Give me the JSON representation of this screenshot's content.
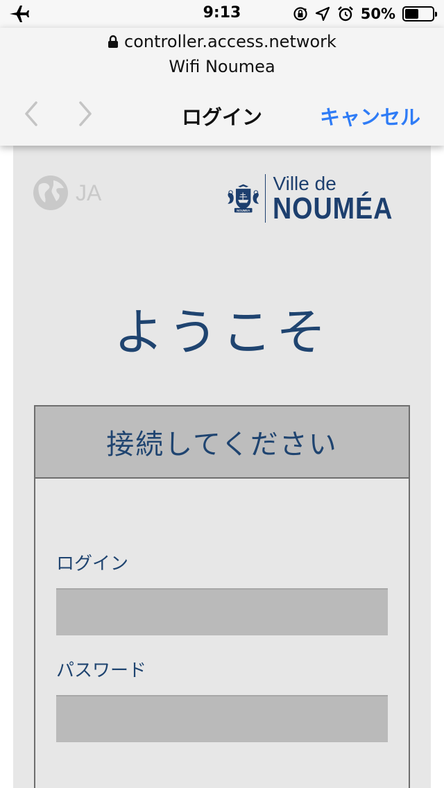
{
  "status_bar": {
    "time": "9:13",
    "battery_percent_label": "50%",
    "battery_level": 0.5,
    "icons": [
      "airplane-icon",
      "rotation-lock-icon",
      "location-arrow-icon",
      "alarm-icon",
      "battery-icon"
    ]
  },
  "browser": {
    "url": "controller.access.network",
    "site_title": "Wifi Noumea",
    "nav_title": "ログイン",
    "cancel_label": "キャンセル",
    "icons": [
      "lock-icon",
      "back-chevron-icon",
      "forward-chevron-icon"
    ]
  },
  "page": {
    "language_code": "JA",
    "logo": {
      "line1": "Ville de",
      "line2": "NOUMÉA",
      "crest_banner": "NOUMEA"
    },
    "welcome": "ようこそ",
    "card_title": "接続してください",
    "login_label": "ログイン",
    "login_value": "",
    "password_label": "パスワード",
    "password_value": "",
    "colors": {
      "brand_blue": "#1f4470",
      "ios_link_blue": "#2f7cf6",
      "page_bg": "#e7e7e7",
      "card_header_bg": "#bdbdbd",
      "input_bg": "#bababa"
    }
  }
}
